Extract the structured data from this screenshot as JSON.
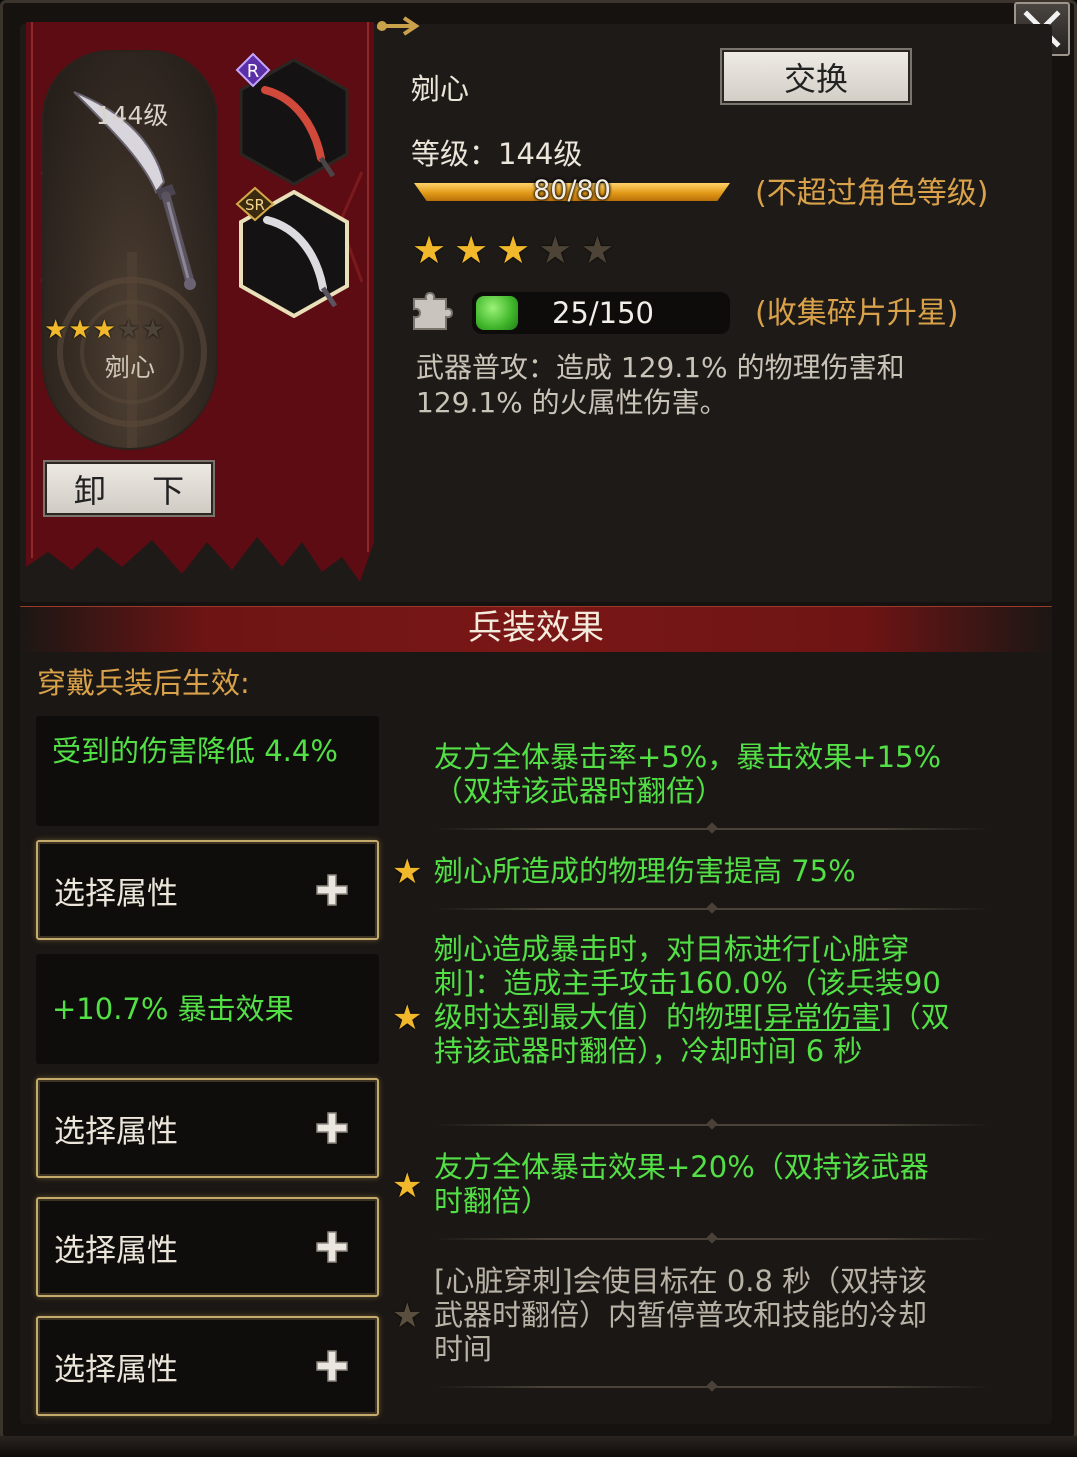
{
  "close_icon": "close-icon",
  "weapon_card": {
    "level": "144级",
    "name": "剜心",
    "stars_filled": 3,
    "stars_total": 5,
    "unequip_label": "卸 下"
  },
  "slots": [
    {
      "rarity": "R",
      "rarity_color": "#6a3ab8"
    },
    {
      "rarity": "SR",
      "rarity_color": "#c8a043"
    }
  ],
  "details": {
    "name": "剜心",
    "swap_label": "交换",
    "level_label": "等级：144级",
    "xp_text": "80/80",
    "xp_fraction": 1.0,
    "level_note": "(不超过角色等级)",
    "stars_filled": 3,
    "stars_total": 5,
    "shards_text": "25/150",
    "shards_note": "(收集碎片升星)",
    "attack_desc": "武器普攻：造成 129.1% 的物理伤害和 129.1% 的火属性伤害。"
  },
  "effects": {
    "title": "兵装效果",
    "subtitle": "穿戴兵装后生效:",
    "attributes": [
      {
        "type": "filled",
        "text": "受到的伤害降低 4.4%"
      },
      {
        "type": "select",
        "text": "选择属性"
      },
      {
        "type": "filled",
        "text": "+10.7% 暴击效果"
      },
      {
        "type": "select",
        "text": "选择属性"
      },
      {
        "type": "select",
        "text": "选择属性"
      },
      {
        "type": "select",
        "text": "选择属性"
      }
    ],
    "list": [
      {
        "star": false,
        "text": "友方全体暴击率+5%，暴击效果+15%（双持该武器时翻倍）"
      },
      {
        "star": true,
        "text": "剜心所造成的物理伤害提高 75%"
      },
      {
        "star": true,
        "text_a": "剜心造成暴击时，对目标进行[心脏穿刺]：造成主手攻击160.0%（该兵装90级时达到最大值）的物理",
        "text_link": "[异常伤害]",
        "text_b": "（双持该武器时翻倍），冷却时间 6 秒"
      },
      {
        "star": true,
        "text": "友方全体暴击效果+20%（双持该武器时翻倍）"
      },
      {
        "star": false,
        "text": "[心脏穿刺]会使目标在 0.8 秒（双持该武器时翻倍）内暂停普攻和技能的冷却时间"
      }
    ]
  },
  "colors": {
    "accent_gold": "#d9a24a",
    "effect_green": "#53e046",
    "banner_red": "#6b0f14"
  }
}
